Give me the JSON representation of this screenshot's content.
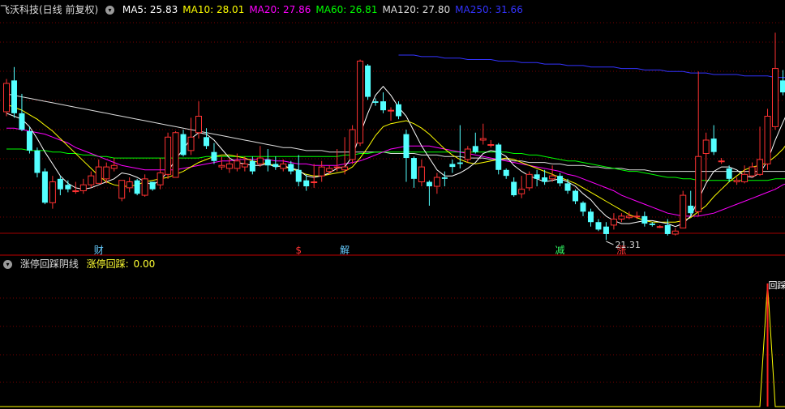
{
  "header": {
    "stock_title": "飞沃科技(日线 前复权)",
    "ma": [
      {
        "label": "MA5:",
        "value": "25.83",
        "color": "#ffffff"
      },
      {
        "label": "MA10:",
        "value": "28.01",
        "color": "#ffff00"
      },
      {
        "label": "MA20:",
        "value": "27.86",
        "color": "#ff00ff"
      },
      {
        "label": "MA60:",
        "value": "26.81",
        "color": "#00ff00"
      },
      {
        "label": "MA120:",
        "value": "27.80",
        "color": "#dddddd"
      },
      {
        "label": "MA250:",
        "value": "31.66",
        "color": "#3333ff"
      }
    ]
  },
  "indicator": {
    "name": "涨停回踩阴线",
    "value_label": "涨停回踩:",
    "value": "0.00",
    "signal_label": "回踩!"
  },
  "markers": [
    {
      "text": "财",
      "color": "#66ccff"
    },
    {
      "text": "$",
      "color": "#ff3333"
    },
    {
      "text": "解",
      "color": "#66ccff"
    },
    {
      "text": "减",
      "color": "#33ff66"
    },
    {
      "text": "涨",
      "color": "#ff3333"
    }
  ],
  "low_label": "21.31",
  "colors": {
    "up": "#ff3232",
    "down": "#54ffff",
    "grid": "#7a0000"
  },
  "chart_data": {
    "type": "candlestick",
    "ylim": [
      20.5,
      35.6
    ],
    "candles": [
      [
        29.3,
        31.2,
        29.0,
        31.5
      ],
      [
        31.4,
        29.2,
        28.9,
        32.3
      ],
      [
        29.2,
        28.1,
        28.0,
        30.5
      ],
      [
        28.0,
        26.7,
        26.5,
        28.3
      ],
      [
        26.7,
        25.2,
        24.9,
        26.9
      ],
      [
        25.3,
        23.2,
        23.1,
        25.5
      ],
      [
        23.2,
        24.6,
        22.8,
        25.0
      ],
      [
        24.8,
        24.1,
        23.7,
        25.0
      ],
      [
        24.4,
        24.1,
        23.9,
        24.7
      ],
      [
        24.0,
        24.0,
        23.8,
        24.6
      ],
      [
        24.0,
        24.4,
        23.8,
        24.8
      ],
      [
        24.4,
        25.0,
        24.2,
        25.3
      ],
      [
        24.5,
        25.6,
        24.5,
        26.1
      ],
      [
        24.8,
        25.6,
        24.5,
        25.9
      ],
      [
        25.5,
        25.7,
        25.3,
        26.2
      ],
      [
        23.5,
        24.7,
        23.3,
        24.7
      ],
      [
        24.2,
        24.6,
        23.9,
        24.9
      ],
      [
        24.7,
        23.8,
        23.7,
        24.8
      ],
      [
        23.7,
        24.8,
        23.6,
        25.1
      ],
      [
        24.6,
        24.1,
        24.0,
        24.5
      ],
      [
        24.4,
        25.2,
        24.1,
        26.2
      ],
      [
        25.1,
        27.6,
        24.8,
        27.9
      ],
      [
        24.9,
        27.9,
        24.9,
        28.0
      ],
      [
        27.8,
        26.4,
        26.3,
        28.1
      ],
      [
        26.7,
        27.6,
        26.4,
        28.9
      ],
      [
        27.9,
        29.0,
        27.5,
        30.0
      ],
      [
        27.6,
        27.0,
        26.8,
        28.2
      ],
      [
        26.6,
        26.0,
        25.8,
        27.2
      ],
      [
        25.6,
        25.7,
        25.4,
        26.3
      ],
      [
        25.5,
        25.8,
        25.2,
        26.2
      ],
      [
        25.5,
        26.0,
        25.3,
        26.5
      ],
      [
        25.6,
        25.8,
        25.3,
        26.3
      ],
      [
        26.0,
        25.3,
        25.1,
        26.3
      ],
      [
        25.8,
        26.2,
        25.6,
        27.0
      ],
      [
        26.1,
        25.7,
        25.3,
        26.8
      ],
      [
        25.8,
        25.6,
        25.4,
        26.3
      ],
      [
        25.5,
        25.8,
        25.3,
        26.1
      ],
      [
        25.8,
        25.3,
        25.1,
        26.0
      ],
      [
        25.4,
        24.6,
        24.3,
        26.4
      ],
      [
        24.7,
        24.3,
        24.0,
        25.1
      ],
      [
        24.6,
        24.6,
        24.2,
        25.8
      ],
      [
        25.0,
        25.6,
        24.6,
        26.0
      ],
      [
        25.3,
        25.5,
        25.1,
        25.7
      ],
      [
        25.6,
        25.6,
        25.3,
        26.8
      ],
      [
        25.4,
        25.6,
        25.1,
        27.6
      ],
      [
        26.1,
        28.1,
        25.8,
        28.4
      ],
      [
        27.2,
        32.7,
        27.0,
        32.8
      ],
      [
        32.4,
        30.3,
        30.1,
        32.5
      ],
      [
        30.0,
        29.9,
        29.7,
        30.2
      ],
      [
        30.0,
        29.4,
        29.2,
        30.6
      ],
      [
        29.4,
        29.4,
        28.7,
        29.6
      ],
      [
        29.8,
        29.0,
        28.8,
        30.0
      ],
      [
        27.8,
        26.2,
        24.6,
        28.1
      ],
      [
        26.2,
        24.8,
        24.2,
        26.3
      ],
      [
        24.6,
        25.6,
        24.3,
        26.1
      ],
      [
        24.6,
        24.3,
        23.0,
        24.7
      ],
      [
        24.3,
        24.9,
        23.8,
        25.2
      ],
      [
        24.9,
        24.8,
        24.3,
        25.3
      ],
      [
        25.8,
        25.6,
        25.2,
        26.1
      ],
      [
        25.9,
        25.8,
        25.5,
        28.4
      ],
      [
        26.1,
        26.8,
        25.9,
        27.0
      ],
      [
        27.0,
        26.6,
        26.5,
        27.9
      ],
      [
        27.4,
        27.5,
        27.1,
        28.5
      ],
      [
        27.1,
        27.1,
        26.9,
        27.4
      ],
      [
        27.1,
        25.4,
        25.1,
        27.2
      ],
      [
        25.4,
        25.0,
        24.8,
        25.5
      ],
      [
        24.6,
        23.7,
        23.6,
        24.9
      ],
      [
        23.8,
        24.1,
        23.5,
        25.0
      ],
      [
        24.2,
        25.1,
        24.0,
        25.3
      ],
      [
        25.1,
        24.8,
        24.3,
        25.4
      ],
      [
        24.9,
        24.6,
        24.4,
        25.4
      ],
      [
        24.8,
        25.0,
        24.6,
        25.7
      ],
      [
        25.0,
        24.5,
        24.3,
        25.2
      ],
      [
        24.5,
        24.0,
        23.8,
        24.8
      ],
      [
        24.0,
        23.3,
        23.1,
        24.1
      ],
      [
        23.2,
        22.6,
        22.3,
        23.3
      ],
      [
        22.6,
        21.9,
        21.6,
        22.8
      ],
      [
        21.9,
        21.4,
        21.3,
        22.1
      ],
      [
        21.6,
        21.1,
        20.7,
        21.9
      ],
      [
        21.7,
        22.1,
        21.4,
        22.5
      ],
      [
        22.1,
        22.3,
        21.9,
        22.5
      ],
      [
        22.2,
        22.3,
        22.1,
        22.6
      ],
      [
        22.3,
        22.3,
        22.1,
        22.6
      ],
      [
        22.3,
        21.8,
        21.6,
        22.6
      ],
      [
        21.8,
        21.7,
        21.6,
        21.9
      ],
      [
        21.6,
        21.6,
        21.5,
        21.7
      ],
      [
        21.7,
        21.1,
        21.0,
        22.1
      ],
      [
        21.1,
        21.3,
        21.0,
        21.5
      ],
      [
        21.5,
        23.7,
        21.5,
        24.0
      ],
      [
        23.0,
        22.5,
        22.3,
        24.0
      ],
      [
        22.6,
        26.3,
        22.3,
        32.0
      ],
      [
        26.5,
        27.4,
        24.6,
        27.9
      ],
      [
        27.5,
        26.6,
        26.4,
        28.4
      ],
      [
        26.0,
        26.0,
        25.8,
        26.2
      ],
      [
        25.5,
        24.8,
        24.6,
        25.7
      ],
      [
        24.6,
        24.7,
        24.4,
        24.9
      ],
      [
        24.6,
        25.1,
        24.5,
        25.7
      ],
      [
        25.0,
        25.6,
        24.9,
        25.9
      ],
      [
        25.1,
        26.1,
        25.0,
        28.3
      ],
      [
        25.8,
        29.0,
        25.4,
        29.5
      ],
      [
        28.3,
        32.2,
        28.1,
        34.6
      ],
      [
        31.4,
        30.6,
        30.4,
        32.1
      ],
      [
        31.3,
        30.5,
        28.1,
        32.1
      ]
    ],
    "ma5": [
      29.2,
      29.0,
      28.8,
      28.3,
      27.5,
      26.6,
      25.8,
      25.0,
      24.5,
      24.2,
      24.1,
      24.2,
      24.4,
      24.6,
      24.8,
      25.2,
      25.1,
      24.9,
      24.6,
      24.4,
      24.7,
      25.3,
      26.1,
      26.8,
      27.5,
      27.9,
      27.8,
      27.4,
      26.8,
      26.2,
      25.9,
      25.8,
      25.7,
      25.7,
      25.8,
      25.6,
      25.7,
      25.5,
      25.4,
      25.0,
      24.9,
      25.0,
      25.2,
      25.5,
      25.6,
      26.3,
      27.8,
      29.2,
      30.4,
      31.0,
      30.4,
      29.6,
      29.0,
      28.0,
      27.0,
      26.2,
      25.4,
      25.0,
      25.0,
      25.2,
      25.5,
      25.9,
      26.5,
      26.7,
      26.6,
      26.3,
      25.7,
      25.3,
      25.0,
      24.8,
      24.6,
      24.7,
      24.8,
      24.6,
      24.3,
      23.8,
      23.4,
      22.8,
      22.3,
      22.0,
      21.8,
      21.8,
      21.9,
      22.0,
      22.0,
      21.9,
      21.8,
      21.6,
      21.8,
      22.3,
      23.4,
      24.5,
      25.3,
      25.6,
      25.6,
      25.4,
      25.0,
      24.9,
      25.2,
      26.0,
      27.4,
      28.6,
      29.7
    ],
    "ma10": [
      29.8,
      29.6,
      29.4,
      29.1,
      28.8,
      28.4,
      28.0,
      27.5,
      27.0,
      26.5,
      26.0,
      25.5,
      25.0,
      24.6,
      24.4,
      24.3,
      24.3,
      24.4,
      24.6,
      24.7,
      24.8,
      24.9,
      25.1,
      25.3,
      25.6,
      25.9,
      26.1,
      26.3,
      26.4,
      26.4,
      26.3,
      26.2,
      26.0,
      25.9,
      25.8,
      25.7,
      25.6,
      25.5,
      25.3,
      25.1,
      25.0,
      25.0,
      25.1,
      25.2,
      25.3,
      25.6,
      26.2,
      26.9,
      27.7,
      28.3,
      28.5,
      28.6,
      28.7,
      28.5,
      28.2,
      27.8,
      27.3,
      26.8,
      26.4,
      26.1,
      25.9,
      25.8,
      25.9,
      26.0,
      26.1,
      26.2,
      26.1,
      25.9,
      25.7,
      25.5,
      25.3,
      25.1,
      24.9,
      24.7,
      24.5,
      24.2,
      23.9,
      23.6,
      23.3,
      23.0,
      22.7,
      22.4,
      22.2,
      22.0,
      21.9,
      21.9,
      21.9,
      21.9,
      22.0,
      22.2,
      22.6,
      23.0,
      23.6,
      24.1,
      24.6,
      25.0,
      25.4,
      25.6,
      25.7,
      25.9,
      26.3,
      26.8,
      27.5
    ],
    "ma20": [
      28.2,
      28.2,
      28.1,
      28.0,
      27.9,
      27.8,
      27.6,
      27.4,
      27.2,
      26.9,
      26.7,
      26.5,
      26.3,
      26.1,
      25.9,
      25.7,
      25.6,
      25.5,
      25.4,
      25.4,
      25.4,
      25.4,
      25.4,
      25.5,
      25.6,
      25.7,
      25.8,
      25.9,
      26.0,
      26.0,
      26.1,
      26.1,
      26.1,
      26.1,
      26.1,
      26.0,
      26.0,
      25.9,
      25.8,
      25.8,
      25.7,
      25.7,
      25.7,
      25.7,
      25.8,
      25.9,
      26.0,
      26.2,
      26.4,
      26.6,
      26.8,
      26.9,
      27.0,
      27.0,
      27.0,
      27.0,
      26.9,
      26.8,
      26.7,
      26.6,
      26.5,
      26.4,
      26.3,
      26.2,
      26.1,
      26.0,
      25.9,
      25.8,
      25.7,
      25.6,
      25.5,
      25.4,
      25.3,
      25.1,
      25.0,
      24.8,
      24.6,
      24.4,
      24.2,
      24.0,
      23.7,
      23.5,
      23.3,
      23.1,
      22.9,
      22.7,
      22.5,
      22.4,
      22.3,
      22.3,
      22.3,
      22.4,
      22.5,
      22.7,
      22.9,
      23.1,
      23.3,
      23.5,
      23.7,
      23.9,
      24.1,
      24.4,
      24.6
    ],
    "ma60": [
      26.8,
      26.8,
      26.8,
      26.7,
      26.7,
      26.7,
      26.6,
      26.6,
      26.5,
      26.5,
      26.4,
      26.4,
      26.3,
      26.3,
      26.2,
      26.2,
      26.2,
      26.2,
      26.2,
      26.2,
      26.2,
      26.2,
      26.2,
      26.2,
      26.2,
      26.2,
      26.3,
      26.3,
      26.3,
      26.3,
      26.3,
      26.3,
      26.3,
      26.3,
      26.3,
      26.3,
      26.3,
      26.3,
      26.3,
      26.3,
      26.3,
      26.3,
      26.3,
      26.3,
      26.4,
      26.4,
      26.5,
      26.5,
      26.6,
      26.6,
      26.6,
      26.6,
      26.6,
      26.6,
      26.6,
      26.6,
      26.6,
      26.6,
      26.6,
      26.6,
      26.6,
      26.6,
      26.6,
      26.6,
      26.6,
      26.6,
      26.5,
      26.5,
      26.4,
      26.4,
      26.3,
      26.2,
      26.1,
      26.0,
      26.0,
      25.9,
      25.8,
      25.7,
      25.6,
      25.5,
      25.4,
      25.3,
      25.3,
      25.2,
      25.1,
      25.0,
      24.9,
      24.9,
      24.8,
      24.8,
      24.7,
      24.7,
      24.7,
      24.7,
      24.7,
      24.7,
      24.7,
      24.7,
      24.7,
      24.7,
      24.8,
      24.8,
      24.8
    ],
    "ma120": [
      30.5,
      30.4,
      30.3,
      30.2,
      30.1,
      30.0,
      29.9,
      29.8,
      29.7,
      29.6,
      29.5,
      29.4,
      29.3,
      29.2,
      29.1,
      29.0,
      28.9,
      28.8,
      28.7,
      28.6,
      28.5,
      28.4,
      28.3,
      28.2,
      28.1,
      28.0,
      27.9,
      27.8,
      27.7,
      27.6,
      27.5,
      27.4,
      27.3,
      27.2,
      27.1,
      27.0,
      26.9,
      26.9,
      26.8,
      26.7,
      26.7,
      26.7,
      26.6,
      26.6,
      26.6,
      26.6,
      26.6,
      26.6,
      26.6,
      26.6,
      26.5,
      26.5,
      26.5,
      26.5,
      26.4,
      26.4,
      26.4,
      26.3,
      26.3,
      26.3,
      26.2,
      26.2,
      26.2,
      26.1,
      26.1,
      26.1,
      26.0,
      26.0,
      25.9,
      25.9,
      25.9,
      25.8,
      25.8,
      25.7,
      25.7,
      25.7,
      25.6,
      25.6,
      25.5,
      25.5,
      25.5,
      25.4,
      25.4,
      25.4,
      25.3,
      25.3,
      25.3,
      25.3,
      25.3,
      25.3,
      25.3,
      25.3,
      25.3,
      25.3,
      25.3,
      25.3,
      25.3,
      25.3,
      25.3,
      25.3,
      25.3,
      25.3,
      25.3
    ],
    "ma250_start": 51,
    "ma250": [
      33.1,
      33.1,
      33.1,
      33.0,
      33.0,
      33.0,
      32.9,
      32.9,
      32.9,
      32.8,
      32.8,
      32.8,
      32.8,
      32.7,
      32.7,
      32.7,
      32.6,
      32.6,
      32.6,
      32.5,
      32.5,
      32.5,
      32.4,
      32.4,
      32.4,
      32.3,
      32.3,
      32.3,
      32.3,
      32.2,
      32.2,
      32.2,
      32.1,
      32.1,
      32.1,
      32.0,
      32.0,
      32.0,
      31.9,
      31.9,
      31.9,
      31.8,
      31.8,
      31.8,
      31.8,
      31.7,
      31.7,
      31.7,
      31.7,
      31.6,
      31.6,
      31.6
    ],
    "indicator_series": {
      "name": "涨停回踩",
      "values": [
        0,
        0,
        0,
        0,
        0,
        0,
        0,
        0,
        0,
        0,
        0,
        0,
        0,
        0,
        0,
        0,
        0,
        0,
        0,
        0,
        0,
        0,
        0,
        0,
        0,
        0,
        0,
        0,
        0,
        0,
        0,
        0,
        0,
        0,
        0,
        0,
        0,
        0,
        0,
        0,
        0,
        0,
        0,
        0,
        0,
        0,
        0,
        0,
        0,
        0,
        0,
        0,
        0,
        0,
        0,
        0,
        0,
        0,
        0,
        0,
        0,
        0,
        0,
        0,
        0,
        0,
        0,
        0,
        0,
        0,
        0,
        0,
        0,
        0,
        0,
        0,
        0,
        0,
        0,
        0,
        0,
        0,
        0,
        0,
        0,
        0,
        0,
        0,
        0,
        0,
        0,
        0,
        0,
        0,
        0,
        0,
        0,
        0,
        0,
        1,
        0,
        0,
        0
      ],
      "ylim": [
        0,
        1
      ]
    },
    "marker_x_index": [
      12,
      38,
      44,
      72,
      80
    ],
    "low_index": 78
  }
}
